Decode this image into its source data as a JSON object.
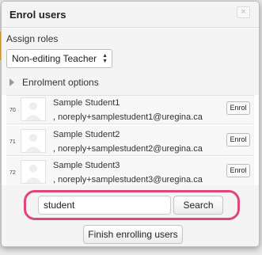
{
  "dialog": {
    "title": "Enrol users",
    "close_icon": "close-icon"
  },
  "roles": {
    "label": "Assign roles",
    "selected": "Non-editing Teacher"
  },
  "enrolment_options": {
    "label": "Enrolment options"
  },
  "results": [
    {
      "num": "70",
      "name": "Sample Student1",
      "email": ", noreply+samplestudent1@uregina.ca",
      "button": "Enrol"
    },
    {
      "num": "71",
      "name": "Sample Student2",
      "email": ", noreply+samplestudent2@uregina.ca",
      "button": "Enrol"
    },
    {
      "num": "72",
      "name": "Sample Student3",
      "email": ", noreply+samplestudent3@uregina.ca",
      "button": "Enrol"
    }
  ],
  "search": {
    "value": "student",
    "button": "Search"
  },
  "finish": {
    "label": "Finish enrolling users"
  },
  "colors": {
    "highlight": "#e0457b",
    "accent_stripe": "#f0ad2e"
  }
}
